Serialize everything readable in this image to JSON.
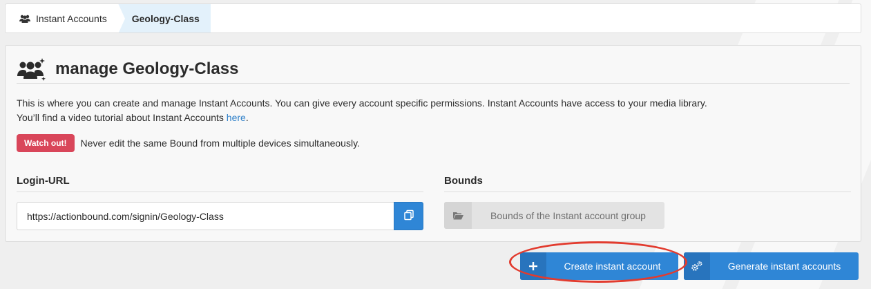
{
  "breadcrumb": {
    "items": [
      {
        "label": "Instant Accounts",
        "icon": "users-icon"
      },
      {
        "label": "Geology-Class"
      }
    ]
  },
  "card": {
    "title": "manage Geology-Class",
    "header_icon": "users-group-icon",
    "description_line1": "This is where you can create and manage Instant Accounts. You can give every account specific permissions. Instant Accounts have access to your media library.",
    "description_line2_prefix": "You’ll find a video tutorial about Instant Accounts ",
    "description_link": "here",
    "description_line2_suffix": ".",
    "warning_badge": "Watch out!",
    "warning_text": "Never edit the same Bound from multiple devices simultaneously."
  },
  "login": {
    "label": "Login-URL",
    "url_value": "https://actionbound.com/signin/Geology-Class",
    "copy_icon": "copy-icon"
  },
  "bounds": {
    "label": "Bounds",
    "button_label": "Bounds of the Instant account group",
    "button_icon": "folder-open-icon"
  },
  "actions": {
    "create_label": "Create instant account",
    "create_icon": "plus-icon",
    "generate_label": "Generate instant accounts",
    "generate_icon": "gears-icon"
  },
  "colors": {
    "primary": "#2f86d6",
    "danger": "#d9465a",
    "link": "#2f80c9",
    "highlight": "#e23b2e"
  }
}
